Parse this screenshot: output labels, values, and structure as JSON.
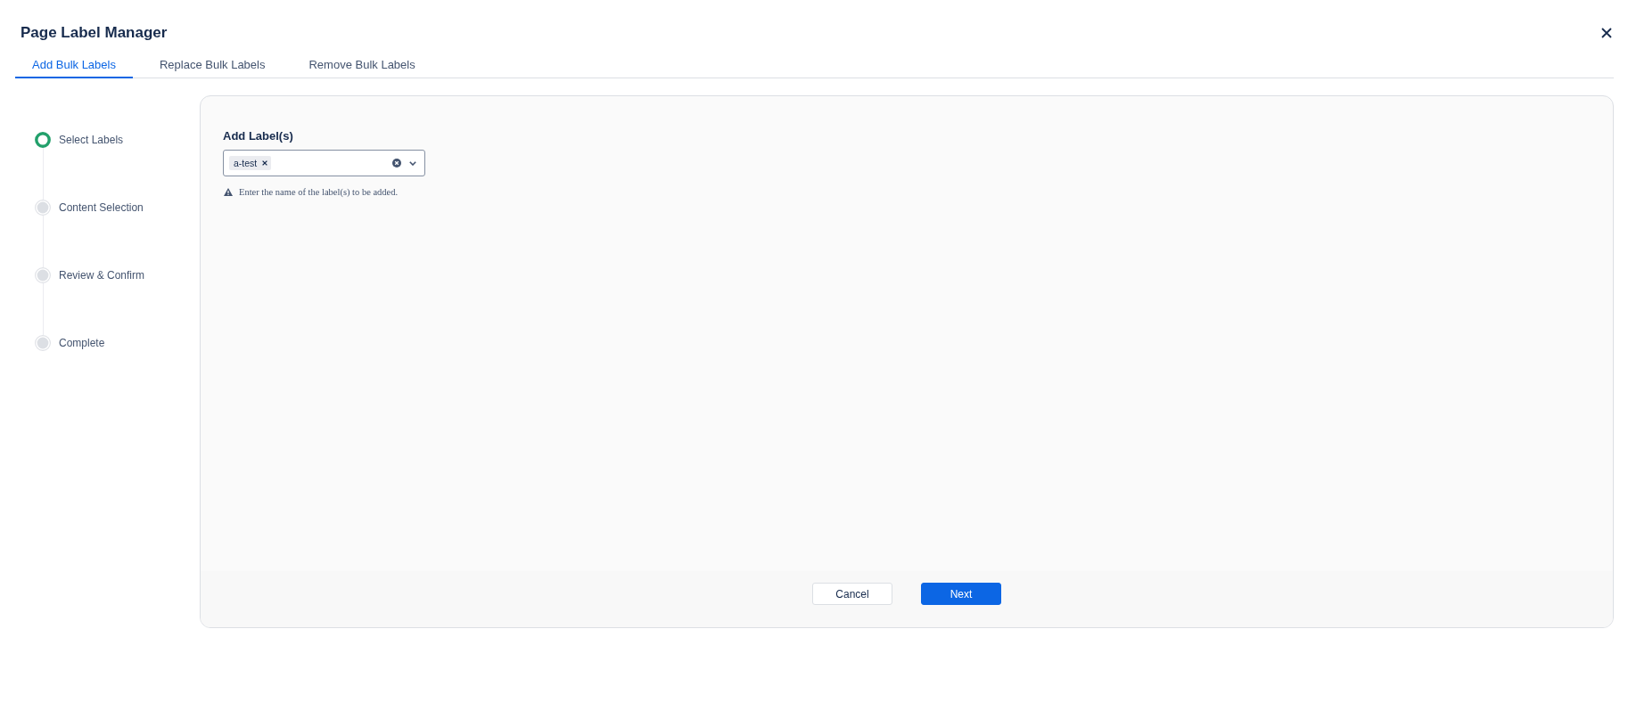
{
  "dialog": {
    "title": "Page Label Manager"
  },
  "tabs": [
    {
      "label": "Add Bulk Labels",
      "selected": true
    },
    {
      "label": "Replace Bulk Labels",
      "selected": false
    },
    {
      "label": "Remove Bulk Labels",
      "selected": false
    }
  ],
  "steps": [
    {
      "label": "Select Labels",
      "current": true
    },
    {
      "label": "Content Selection",
      "current": false
    },
    {
      "label": "Review & Confirm",
      "current": false
    },
    {
      "label": "Complete",
      "current": false
    }
  ],
  "form": {
    "label": "Add Label(s)",
    "tags": [
      {
        "text": "a-test"
      }
    ],
    "hint": "Enter the name of the label(s) to be added."
  },
  "buttons": [
    {
      "label": "Cancel",
      "kind": "secondary"
    },
    {
      "label": "Next",
      "kind": "primary"
    }
  ]
}
